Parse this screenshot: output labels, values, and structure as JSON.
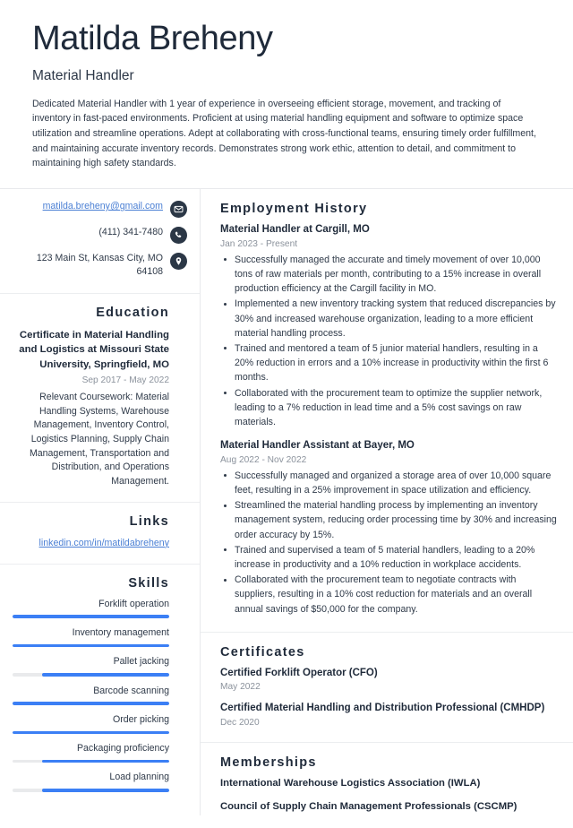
{
  "header": {
    "name": "Matilda Breheny",
    "title": "Material Handler",
    "summary": "Dedicated Material Handler with 1 year of experience in overseeing efficient storage, movement, and tracking of inventory in fast-paced environments. Proficient at using material handling equipment and software to optimize space utilization and streamline operations. Adept at collaborating with cross-functional teams, ensuring timely order fulfillment, and maintaining accurate inventory records. Demonstrates strong work ethic, attention to detail, and commitment to maintaining high safety standards."
  },
  "colors": {
    "accent_blue": "#3b7ff5",
    "link_blue": "#4a7fd4",
    "icon_navy": "#2b3746",
    "heading_navy": "#1f2a3a",
    "muted_gray": "#8b929c",
    "track_gray": "#e9eaec",
    "divider": "#eceef0"
  },
  "contact": {
    "email": "matilda.breheny@gmail.com",
    "phone": "(411) 341-7480",
    "address": "123 Main St, Kansas City, MO 64108",
    "icons": [
      "envelope-icon",
      "phone-icon",
      "map-pin-icon"
    ]
  },
  "education": {
    "heading": "Education",
    "degree": "Certificate in Material Handling and Logistics at Missouri State University, Springfield, MO",
    "date": "Sep 2017 - May 2022",
    "description": "Relevant Coursework: Material Handling Systems, Warehouse Management, Inventory Control, Logistics Planning, Supply Chain Management, Transportation and Distribution, and Operations Management."
  },
  "links": {
    "heading": "Links",
    "items": [
      {
        "label": "linkedin.com/in/matildabreheny"
      }
    ]
  },
  "skills": {
    "heading": "Skills",
    "items": [
      {
        "label": "Forklift operation",
        "level": 100
      },
      {
        "label": "Inventory management",
        "level": 100
      },
      {
        "label": "Pallet jacking",
        "level": 81
      },
      {
        "label": "Barcode scanning",
        "level": 100
      },
      {
        "label": "Order picking",
        "level": 100
      },
      {
        "label": "Packaging proficiency",
        "level": 81
      },
      {
        "label": "Load planning",
        "level": 81
      }
    ]
  },
  "employment": {
    "heading": "Employment History",
    "entries": [
      {
        "title": "Material Handler at Cargill, MO",
        "date": "Jan 2023 - Present",
        "bullets": [
          "Successfully managed the accurate and timely movement of over 10,000 tons of raw materials per month, contributing to a 15% increase in overall production efficiency at the Cargill facility in MO.",
          "Implemented a new inventory tracking system that reduced discrepancies by 30% and increased warehouse organization, leading to a more efficient material handling process.",
          "Trained and mentored a team of 5 junior material handlers, resulting in a 20% reduction in errors and a 10% increase in productivity within the first 6 months.",
          "Collaborated with the procurement team to optimize the supplier network, leading to a 7% reduction in lead time and a 5% cost savings on raw materials."
        ]
      },
      {
        "title": "Material Handler Assistant at Bayer, MO",
        "date": "Aug 2022 - Nov 2022",
        "bullets": [
          "Successfully managed and organized a storage area of over 10,000 square feet, resulting in a 25% improvement in space utilization and efficiency.",
          "Streamlined the material handling process by implementing an inventory management system, reducing order processing time by 30% and increasing order accuracy by 15%.",
          "Trained and supervised a team of 5 material handlers, leading to a 20% increase in productivity and a 10% reduction in workplace accidents.",
          "Collaborated with the procurement team to negotiate contracts with suppliers, resulting in a 10% cost reduction for materials and an overall annual savings of $50,000 for the company."
        ]
      }
    ]
  },
  "certificates": {
    "heading": "Certificates",
    "entries": [
      {
        "title": "Certified Forklift Operator (CFO)",
        "date": "May 2022"
      },
      {
        "title": "Certified Material Handling and Distribution Professional (CMHDP)",
        "date": "Dec 2020"
      }
    ]
  },
  "memberships": {
    "heading": "Memberships",
    "entries": [
      {
        "title": "International Warehouse Logistics Association (IWLA)"
      },
      {
        "title": "Council of Supply Chain Management Professionals (CSCMP)"
      }
    ]
  }
}
